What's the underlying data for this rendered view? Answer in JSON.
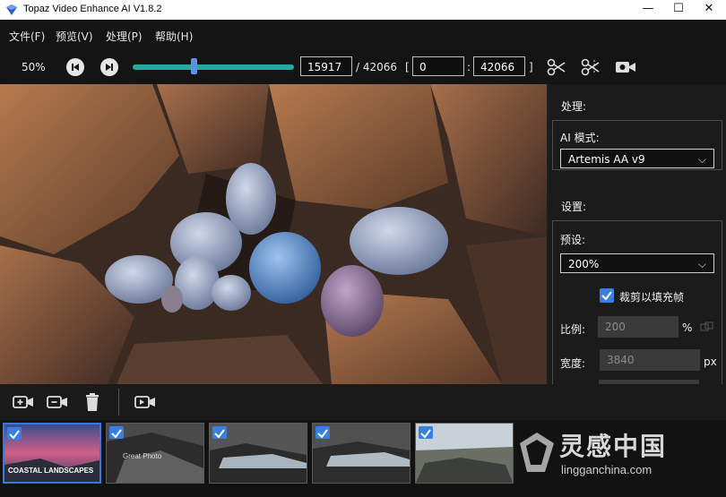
{
  "window": {
    "title": "Topaz Video Enhance AI V1.8.2",
    "minimize": "—",
    "maximize": "☐",
    "close": "✕"
  },
  "menu": [
    {
      "label": "文件(F)"
    },
    {
      "label": "预览(V)"
    },
    {
      "label": "处理(P)"
    },
    {
      "label": "帮助(H)"
    }
  ],
  "toolbar": {
    "zoom": "50%",
    "current_frame": "15917",
    "total_frames": "/ 42066",
    "range_open": "[",
    "range_start": "0",
    "range_sep": ":",
    "range_end": "42066",
    "range_close": "]",
    "slider_progress": 0.378
  },
  "panel": {
    "process_title": "处理:",
    "ai_mode_label": "AI 模式:",
    "ai_mode_value": "Artemis AA v9",
    "settings_title": "设置:",
    "preset_label": "预设:",
    "preset_value": "200%",
    "crop_checkbox_label": "裁剪以填充帧",
    "crop_checked": true,
    "ratio_label": "比例:",
    "ratio_value": "200",
    "ratio_unit": "%",
    "width_label": "宽度:",
    "width_value": "3840",
    "width_unit": "px"
  },
  "thumbnails": [
    {
      "caption": "COASTAL LANDSCAPES",
      "checked": true,
      "selected": true
    },
    {
      "caption": "Great Photo",
      "checked": true,
      "selected": false
    },
    {
      "caption": "",
      "checked": true,
      "selected": false
    },
    {
      "caption": "",
      "checked": true,
      "selected": false
    },
    {
      "caption": "",
      "checked": true,
      "selected": false
    }
  ],
  "watermark": {
    "brand": "灵感中国",
    "url": "lingganchina.com"
  },
  "colors": {
    "accent": "#3a7fe0",
    "slider_track": "#2aa8a0"
  }
}
